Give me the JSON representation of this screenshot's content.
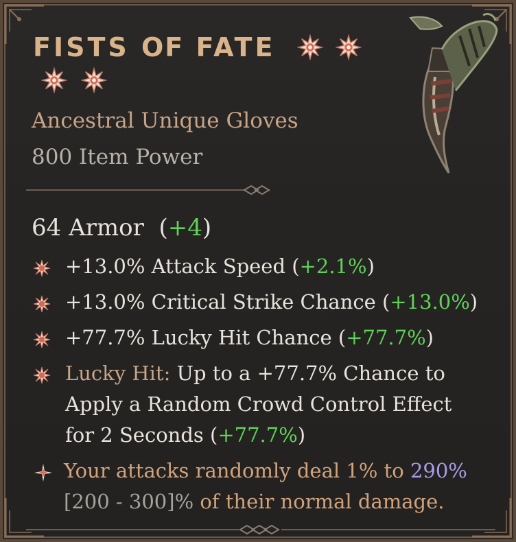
{
  "item": {
    "name_part1": "FISTS ",
    "name_part2": "OF",
    "name_part3": " FATE",
    "type": "Ancestral Unique Gloves",
    "power": "800 Item Power",
    "aspect_icon": "greater-affix-star-icon",
    "image_icon": "gauntlet-icon"
  },
  "armor": {
    "label": "64 Armor",
    "open": "(",
    "bonus": "+4",
    "close": ")"
  },
  "affixes": [
    {
      "text": "+13.0% Attack Speed ",
      "open": "(",
      "bonus": "+2.1%",
      "close": ")"
    },
    {
      "text": "+13.0% Critical Strike Chance ",
      "open": "(",
      "bonus": "+13.0%",
      "close": ")"
    },
    {
      "text": "+77.7% Lucky Hit Chance ",
      "open": "(",
      "bonus": "+77.7%",
      "close": ")"
    },
    {
      "label": "Lucky Hit:",
      "line1": " Up to a +77.7% Chance to",
      "line2": "Apply a Random Crowd Control Effect",
      "line3": "for 2 Seconds ",
      "open": "(",
      "bonus": "+77.7%",
      "close": ")"
    }
  ],
  "unique_power": {
    "pre": "Your attacks randomly deal 1% to ",
    "roll": "290%",
    "range": "[200 - 300]%",
    "post": " of their normal damage."
  },
  "colors": {
    "title": "#d9b38a",
    "bonus_green": "#5fd35a",
    "unique_orange": "#d0a37c",
    "roll_purple": "#a79de8"
  }
}
